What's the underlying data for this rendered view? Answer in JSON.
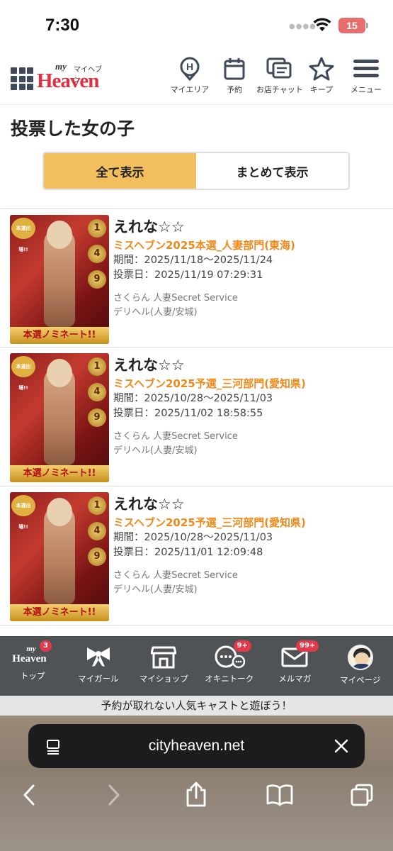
{
  "status": {
    "time": "7:30",
    "battery": "15"
  },
  "header": {
    "logo_my": "my",
    "logo_kana": "マイヘブン",
    "logo_main": "Heaven",
    "nav": [
      {
        "label": "マイエリア",
        "icon": "map-pin-h-icon"
      },
      {
        "label": "予約",
        "icon": "calendar-icon"
      },
      {
        "label": "お店チャット",
        "icon": "chat-icon"
      },
      {
        "label": "キープ",
        "icon": "star-icon"
      },
      {
        "label": "メニュー",
        "icon": "hamburger-menu-icon"
      }
    ]
  },
  "page": {
    "title": "投票した女の子"
  },
  "toggle": {
    "all_label": "全て表示",
    "grouped_label": "まとめて表示",
    "active": "all"
  },
  "thumb": {
    "badge": "本選出場!!",
    "banner": "本選ノミネート!!",
    "medals": [
      "1",
      "4",
      "9"
    ]
  },
  "votes": [
    {
      "name": "えれな☆☆",
      "event": "ミスヘブン2025本選_人妻部門(東海)",
      "period": "期間：2025/11/18〜2025/11/24",
      "vote_date": "投票日：2025/11/19 07:29:31",
      "shop": "さくらん 人妻Secret Service",
      "genre": "デリヘル(人妻/安城)"
    },
    {
      "name": "えれな☆☆",
      "event": "ミスヘブン2025予選_三河部門(愛知県)",
      "period": "期間：2025/10/28〜2025/11/03",
      "vote_date": "投票日：2025/11/02 18:58:55",
      "shop": "さくらん 人妻Secret Service",
      "genre": "デリヘル(人妻/安城)"
    },
    {
      "name": "えれな☆☆",
      "event": "ミスヘブン2025予選_三河部門(愛知県)",
      "period": "期間：2025/10/28〜2025/11/03",
      "vote_date": "投票日：2025/11/01 12:09:48",
      "shop": "さくらん 人妻Secret Service",
      "genre": "デリヘル(人妻/安城)"
    }
  ],
  "bottom_nav": {
    "top": {
      "label": "トップ",
      "badge": "3",
      "logo_my": "my",
      "logo_main": "Heaven"
    },
    "my_girl": {
      "label": "マイガール",
      "icon": "ribbon-icon"
    },
    "my_shop": {
      "label": "マイショップ",
      "icon": "shop-icon"
    },
    "okini_talk": {
      "label": "オキニトーク",
      "badge": "9+",
      "icon": "talk-bubbles-icon"
    },
    "mail_magazine": {
      "label": "メルマガ",
      "badge": "99+",
      "icon": "mail-icon"
    },
    "my_page": {
      "label": "マイページ",
      "icon": "avatar"
    }
  },
  "promo": {
    "text": "予約が取れない人気キャストと遊ぼう！"
  },
  "browser": {
    "url": "cityheaven.net"
  }
}
